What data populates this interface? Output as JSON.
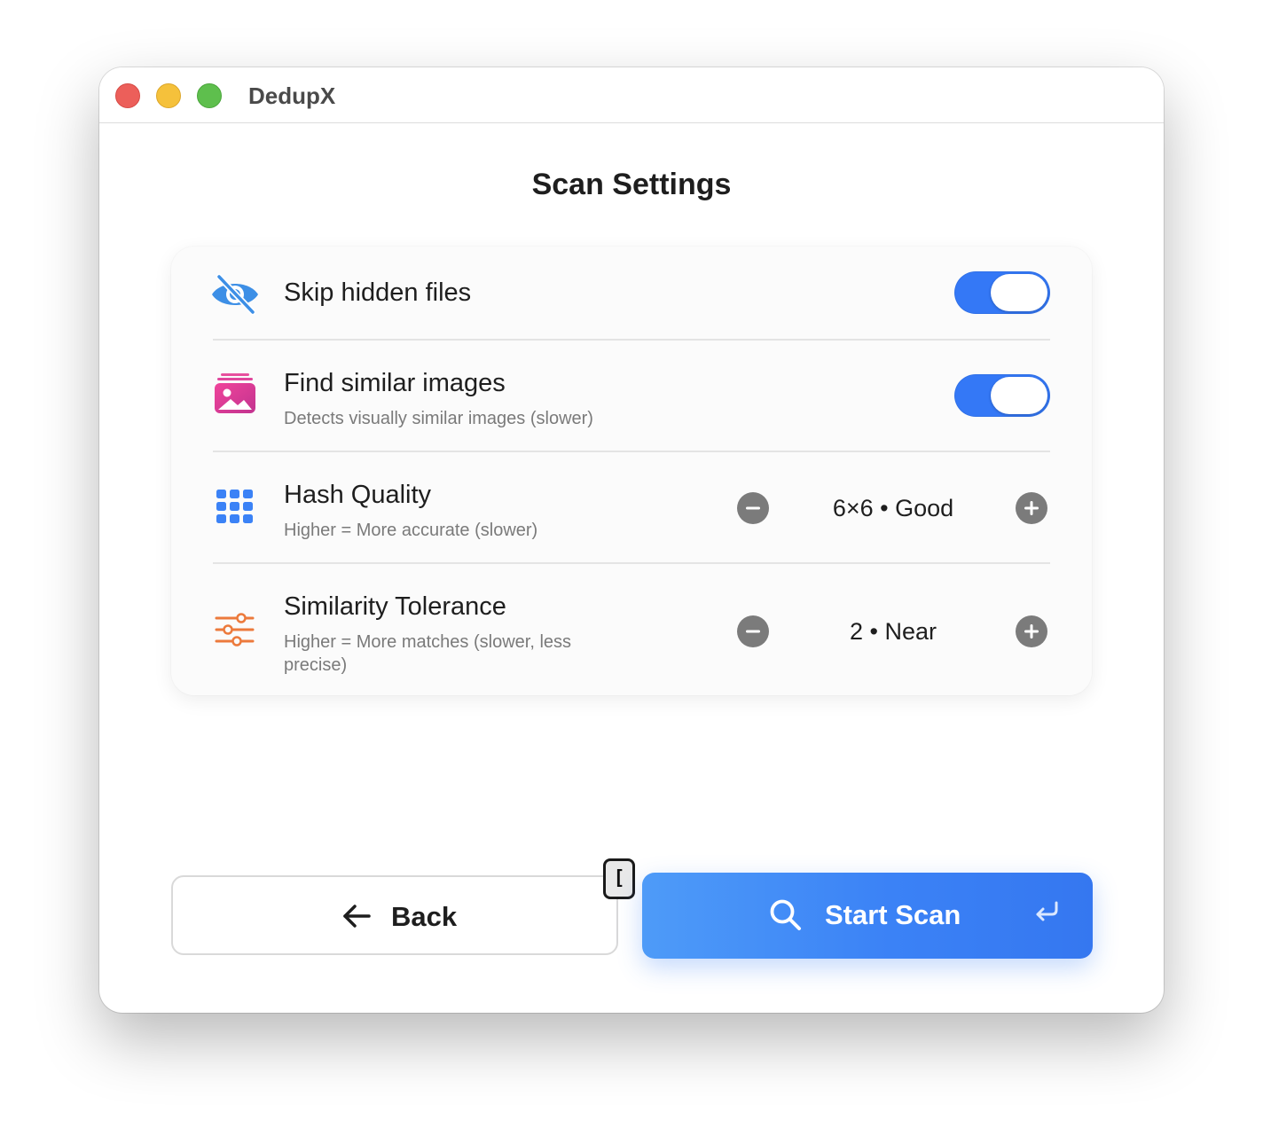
{
  "window": {
    "title": "DedupX"
  },
  "page": {
    "title": "Scan Settings"
  },
  "settings": {
    "skip_hidden": {
      "label": "Skip hidden files",
      "icon": "eye-slash-icon",
      "enabled": true
    },
    "similar_images": {
      "label": "Find similar images",
      "description": "Detects visually similar images (slower)",
      "icon": "photo-stack-icon",
      "enabled": true
    },
    "hash_quality": {
      "label": "Hash Quality",
      "description": "Higher = More accurate (slower)",
      "value": "6×6 • Good",
      "icon": "grid-icon"
    },
    "tolerance": {
      "label": "Similarity Tolerance",
      "description": "Higher = More matches (slower, less precise)",
      "value": "2 • Near",
      "icon": "sliders-icon"
    }
  },
  "footer": {
    "back_label": "Back",
    "start_label": "Start Scan",
    "shortcut_key": "["
  },
  "colors": {
    "accent": "#3478f6",
    "close": "#ec5f5a",
    "minimize": "#f5c13b",
    "maximize": "#5ebf4d",
    "eye_icon": "#3d8fe6",
    "photo_icon": "#e0379a",
    "grid_icon": "#3b82f6",
    "sliders_icon": "#ec7a3c"
  }
}
